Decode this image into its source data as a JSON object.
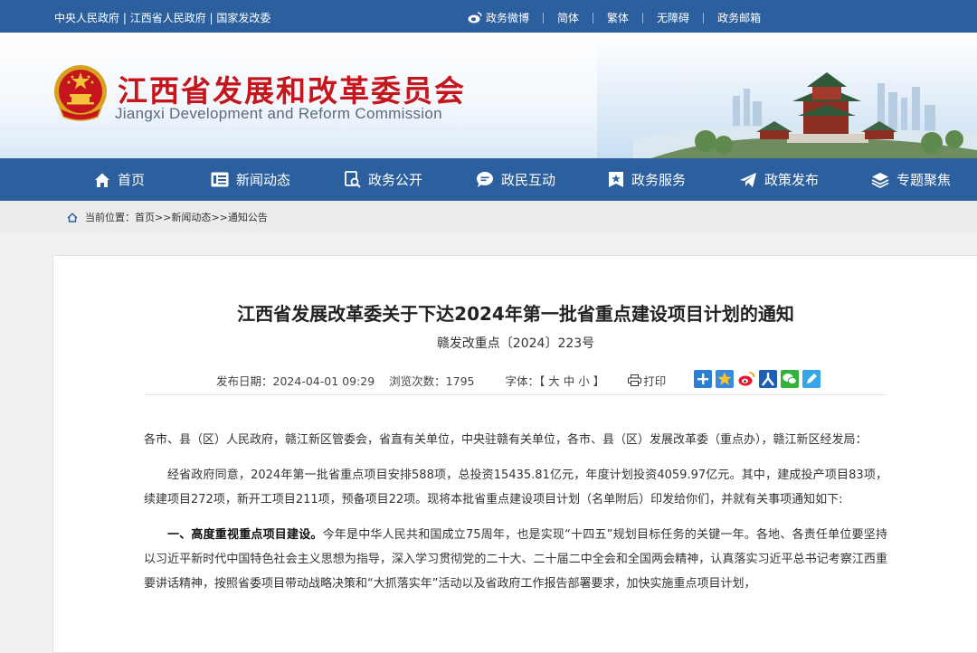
{
  "topbar": {
    "links": [
      "中央人民政府",
      "江西省人民政府",
      "国家发改委"
    ],
    "weibo": "政务微博",
    "simplified": "简体",
    "traditional": "繁体",
    "accessible": "无障碍",
    "mail": "政务邮箱"
  },
  "header": {
    "title": "江西省发展和改革委员会",
    "subtitle": "Jiangxi Development and Reform Commission"
  },
  "nav": [
    {
      "label": "首页",
      "icon": "home-icon"
    },
    {
      "label": "新闻动态",
      "icon": "news-icon"
    },
    {
      "label": "政务公开",
      "icon": "search-doc-icon"
    },
    {
      "label": "政民互动",
      "icon": "chat-icon"
    },
    {
      "label": "政务服务",
      "icon": "star-badge-icon"
    },
    {
      "label": "政策发布",
      "icon": "paper-plane-icon"
    },
    {
      "label": "专题聚焦",
      "icon": "layers-icon"
    }
  ],
  "breadcrumb": {
    "prefix": "当前位置：",
    "home": "首页",
    "sep": ">>",
    "section": "新闻动态",
    "current": "通知公告"
  },
  "article": {
    "title": "江西省发展改革委关于下达2024年第一批省重点建设项目计划的通知",
    "doc_number": "赣发改重点〔2024〕223号",
    "publish_label": "发布日期：",
    "publish_date": "2024-04-01 09:29",
    "views_label": "浏览次数：",
    "views": "1795",
    "font_label": "字体：【",
    "font_large": "大",
    "font_medium": "中",
    "font_small": "小",
    "font_end": "】",
    "print": "打印",
    "p1": "各市、县（区）人民政府，赣江新区管委会，省直有关单位，中央驻赣有关单位，各市、县（区）发展改革委（重点办），赣江新区经发局：",
    "p2": "经省政府同意，2024年第一批省重点项目安排588项，总投资15435.81亿元，年度计划投资4059.97亿元。其中，建成投产项目83项，续建项目272项，新开工项目211项，预备项目22项。现将本批省重点建设项目计划（名单附后）印发给你们，并就有关事项通知如下:",
    "p3_bold": "一、高度重视重点项目建设。",
    "p3": "今年是中华人民共和国成立75周年，也是实现“十四五”规划目标任务的关键一年。各地、各责任单位要坚持以习近平新时代中国特色社会主义思想为指导，深入学习贯彻党的二十大、二十届二中全会和全国两会精神，认真落实习近平总书记考察江西重要讲话精神，按照省委项目带动战略决策和“大抓落实年”活动以及省政府工作报告部署要求，加快实施重点项目计划，"
  },
  "colors": {
    "brand_blue": "#2c5f9e",
    "title_red": "#c4161c"
  }
}
